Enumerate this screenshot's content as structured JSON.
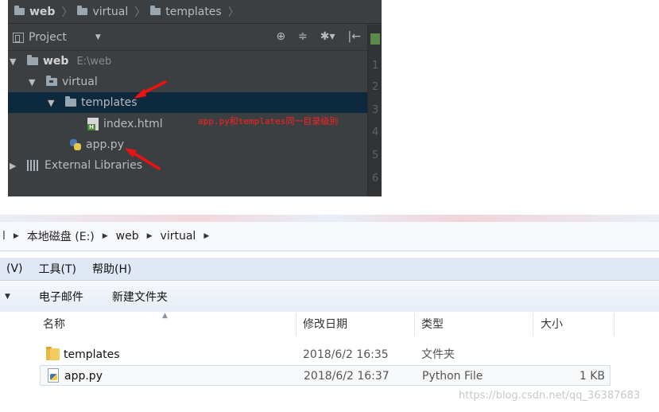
{
  "ide": {
    "breadcrumbs": [
      "web",
      "virtual",
      "templates"
    ],
    "panel_title": "Project",
    "toolbar_icons": [
      "target-icon",
      "collapse-icon",
      "gear-icon",
      "hide-icon"
    ],
    "toolbar_glyphs": [
      "⊕",
      "≑",
      "✱▾",
      "|←"
    ],
    "line_numbers": [
      "1",
      "2",
      "3",
      "4",
      "5",
      "6"
    ],
    "tree": {
      "root_name": "web",
      "root_path": "E:\\web",
      "virtual": "virtual",
      "templates": "templates",
      "index_html": "index.html",
      "app_py": "app.py",
      "external_libraries": "External Libraries"
    },
    "annotation": "app.py和templates同一目录级别",
    "annotation_color": "#ff2020",
    "selection_color": "#0d293e"
  },
  "explorer": {
    "address": {
      "first": "l",
      "parts": [
        "本地磁盘 (E:)",
        "web",
        "virtual"
      ]
    },
    "menu": [
      "(V)",
      "工具(T)",
      "帮助(H)"
    ],
    "commands": [
      "电子邮件",
      "新建文件夹"
    ],
    "columns": {
      "name": "名称",
      "date": "修改日期",
      "type": "类型",
      "size": "大小"
    },
    "files": [
      {
        "name": "templates",
        "date": "2018/6/2 16:35",
        "type": "文件夹",
        "size": "",
        "icon": "folder-icon"
      },
      {
        "name": "app.py",
        "date": "2018/6/2 16:37",
        "type": "Python File",
        "size": "1 KB",
        "icon": "python-file-icon"
      }
    ],
    "watermark": "https://blog.csdn.net/qq_36387683"
  }
}
